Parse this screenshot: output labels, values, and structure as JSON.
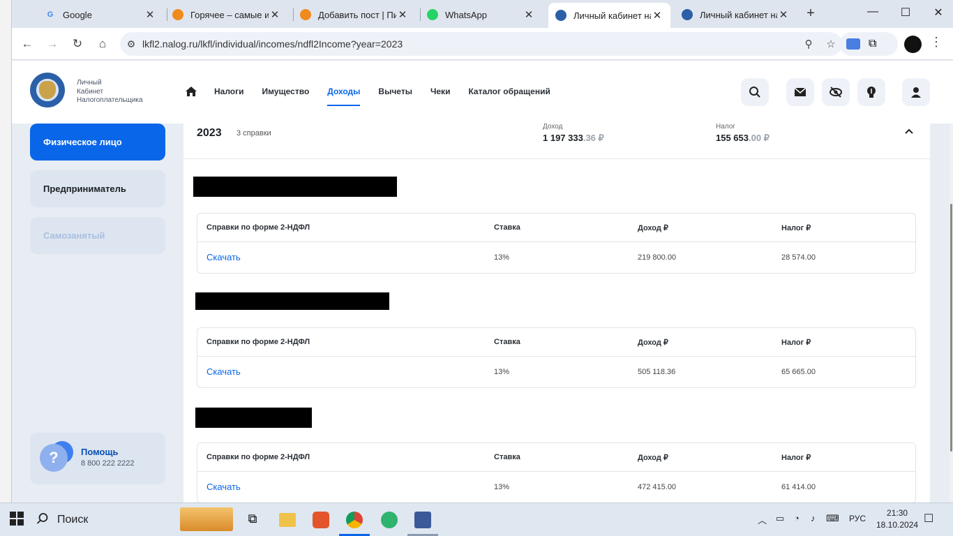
{
  "browser": {
    "tabs": [
      {
        "title": "Google",
        "active": false
      },
      {
        "title": "Горячее – самые ин",
        "active": false
      },
      {
        "title": "Добавить пост | Пик",
        "active": false
      },
      {
        "title": "WhatsApp",
        "active": false
      },
      {
        "title": "Личный кабинет на",
        "active": true
      },
      {
        "title": "Личный кабинет на",
        "active": false
      }
    ],
    "url": "lkfl2.nalog.ru/lkfl/individual/incomes/ndfl2Income?year=2023"
  },
  "header": {
    "brand_line1": "Личный",
    "brand_line2": "Кабинет",
    "brand_line3": "Налогоплательщика",
    "nav": [
      "Налоги",
      "Имущество",
      "Доходы",
      "Вычеты",
      "Чеки",
      "Каталог обращений"
    ],
    "active_nav": "Доходы"
  },
  "sidebar": {
    "items": [
      {
        "label": "Физическое лицо"
      },
      {
        "label": "Предприниматель"
      },
      {
        "label": "Самозанятый"
      }
    ],
    "help_title": "Помощь",
    "help_phone": "8 800 222 2222"
  },
  "summary": {
    "year": "2023",
    "count": "3 справки",
    "income_label": "Доход",
    "income_main": "1 197 333",
    "income_kop": ".36 ₽",
    "tax_label": "Налог",
    "tax_main": "155 653",
    "tax_kop": ".00 ₽"
  },
  "table_headers": {
    "form": "Справки по форме 2-НДФЛ",
    "rate": "Ставка",
    "income": "Доход ₽",
    "tax": "Налог ₽"
  },
  "certificates": [
    {
      "download": "Скачать",
      "rate": "13%",
      "income": "219 800.00",
      "tax": "28 574.00"
    },
    {
      "download": "Скачать",
      "rate": "13%",
      "income": "505 118.36",
      "tax": "65 665.00"
    },
    {
      "download": "Скачать",
      "rate": "13%",
      "income": "472 415.00",
      "tax": "61 414.00"
    }
  ],
  "taskbar": {
    "search_label": "Поиск",
    "lang": "РУС",
    "time": "21:30",
    "date": "18.10.2024"
  },
  "colors": {
    "accent": "#0a66e8",
    "sidebar_active": "#0a66e8",
    "page_bg": "#e8edf3"
  }
}
